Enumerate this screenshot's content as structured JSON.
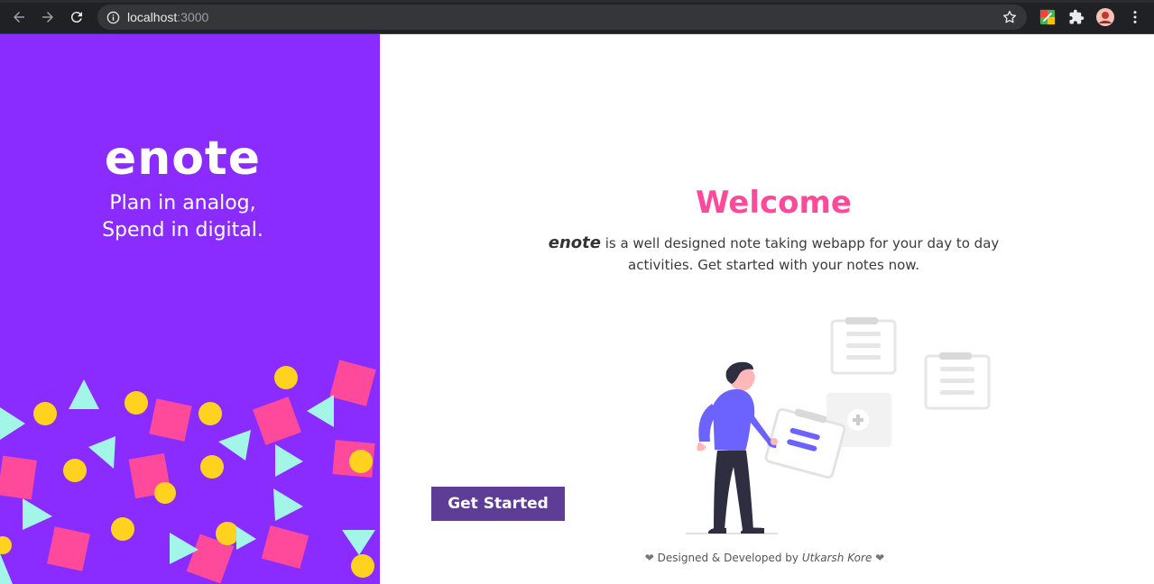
{
  "browser": {
    "url_host": "localhost",
    "url_port": ":3000",
    "icons": [
      "back-icon",
      "forward-icon",
      "reload-icon",
      "info-icon",
      "star-icon",
      "extension-icon",
      "puzzle-icon",
      "avatar",
      "menu-icon"
    ]
  },
  "sidebar": {
    "brand": "enote",
    "tagline_line1": "Plan in analog,",
    "tagline_line2": "Spend in digital.",
    "bg_color": "#8a2bff",
    "shape_colors": {
      "square": "#ff4a9c",
      "circle": "#ffd21f",
      "triangle": "#a3f5e8"
    }
  },
  "main": {
    "title": "Welcome",
    "title_color": "#ff4a9c",
    "desc_brand": "enote",
    "desc_text": " is a well designed note taking webapp for your day to day activities. Get started with your notes now.",
    "cta_label": "Get Started",
    "cta_color": "#5e3d96"
  },
  "footer": {
    "heart": "❤",
    "prefix": " Designed & Developed by ",
    "author": "Utkarsh Kore",
    "heart2": "❤"
  }
}
